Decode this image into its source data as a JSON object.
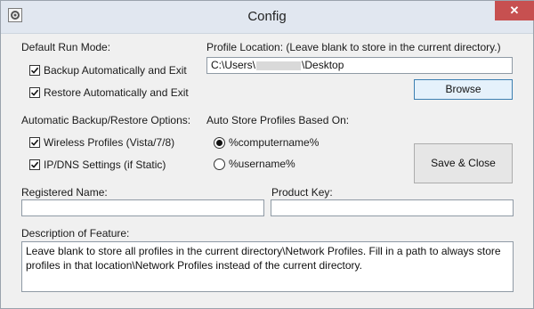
{
  "window": {
    "title": "Config",
    "close_glyph": "✕"
  },
  "run_mode": {
    "label": "Default Run Mode:",
    "backup_label": "Backup Automatically and Exit",
    "backup_checked": true,
    "restore_label": "Restore Automatically and Exit",
    "restore_checked": true
  },
  "profile_location": {
    "label": "Profile Location:  (Leave blank to store in the current directory.)",
    "value_prefix": "C:\\Users\\",
    "value_suffix": "\\Desktop",
    "browse_label": "Browse"
  },
  "options": {
    "label": "Automatic Backup/Restore Options:",
    "wireless_label": "Wireless Profiles (Vista/7/8)",
    "wireless_checked": true,
    "ipdns_label": "IP/DNS Settings (if Static)",
    "ipdns_checked": true
  },
  "auto_store": {
    "label": "Auto Store Profiles Based On:",
    "computername_label": "%computername%",
    "username_label": "%username%",
    "selected": "computername"
  },
  "save_close_label": "Save & Close",
  "registered_name": {
    "label": "Registered Name:",
    "value": ""
  },
  "product_key": {
    "label": "Product Key:",
    "value": ""
  },
  "description": {
    "label": "Description of Feature:",
    "text": "Leave blank to store all profiles in the current directory\\Network Profiles.  Fill in a path to always store profiles in that location\\Network Profiles instead of the current directory."
  },
  "icons": {
    "app": "settings-window-icon",
    "close": "close-icon",
    "check": "checkmark-icon",
    "radio": "radio-dot-icon"
  }
}
